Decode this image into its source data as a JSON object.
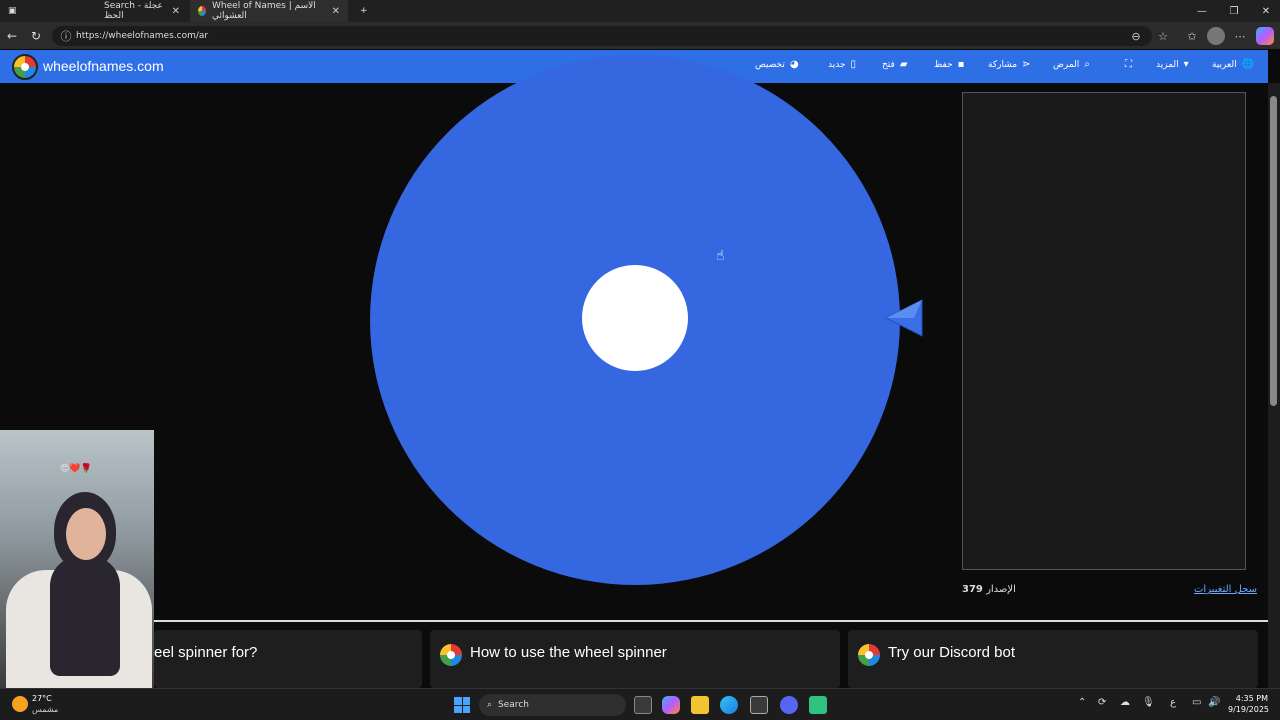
{
  "browser": {
    "tabs": [
      {
        "label": "Search - عجلة الحظ",
        "active": false
      },
      {
        "label": "Wheel of Names | الاسم العشوائي",
        "active": true
      }
    ],
    "new_tab": "+",
    "url": "https://wheelofnames.com/ar"
  },
  "site": {
    "name": "wheelofnames.com",
    "menu": [
      {
        "label": "العربية",
        "icon": "globe-icon"
      },
      {
        "label": "المزيد",
        "icon": "caret-down-icon"
      },
      {
        "label": "",
        "icon": "fullscreen-icon"
      },
      {
        "label": "المرض",
        "icon": "search-icon"
      },
      {
        "label": "مشاركة",
        "icon": "share-icon"
      },
      {
        "label": "حفظ",
        "icon": "save-icon"
      },
      {
        "label": "فتح",
        "icon": "folder-icon"
      },
      {
        "label": "جديد",
        "icon": "file-icon"
      },
      {
        "label": "تخصيص",
        "icon": "palette-icon"
      }
    ]
  },
  "wheel": {
    "color": "#3567e0",
    "center_color": "#ffffff"
  },
  "side_panel": {
    "version_label": "الإصدار",
    "version_number": "379",
    "changelog_link": "سجل التغييرات"
  },
  "cards": [
    {
      "title": "eel spinner for?"
    },
    {
      "title": "How to use the wheel spinner"
    },
    {
      "title": "Try our Discord bot"
    }
  ],
  "taskbar": {
    "weather_temp": "27°C",
    "weather_desc": "مشمس",
    "search_label": "Search",
    "lang": "ع",
    "time": "4:35 PM",
    "date": "9/19/2025"
  },
  "webcam": {
    "emoji": "😍❤️🌹"
  }
}
